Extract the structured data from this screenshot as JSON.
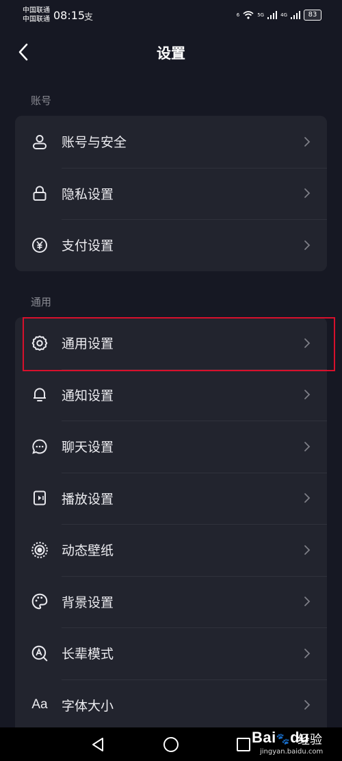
{
  "status_bar": {
    "carrier_1": "中国联通",
    "carrier_2": "中国联通",
    "time": "08:15",
    "notification_icon": "alipay-icon",
    "wifi_label": "6",
    "network_1": "5G",
    "network_2": "4G",
    "battery": "83"
  },
  "header": {
    "title": "设置",
    "back_icon": "chevron-left-icon"
  },
  "sections": [
    {
      "label": "账号",
      "items": [
        {
          "label": "账号与安全",
          "icon": "user-icon"
        },
        {
          "label": "隐私设置",
          "icon": "lock-icon"
        },
        {
          "label": "支付设置",
          "icon": "yen-icon"
        }
      ]
    },
    {
      "label": "通用",
      "items": [
        {
          "label": "通用设置",
          "icon": "gear-icon",
          "highlighted": true
        },
        {
          "label": "通知设置",
          "icon": "bell-icon"
        },
        {
          "label": "聊天设置",
          "icon": "chat-bubble-icon"
        },
        {
          "label": "播放设置",
          "icon": "play-icon"
        },
        {
          "label": "动态壁纸",
          "icon": "wallpaper-icon"
        },
        {
          "label": "背景设置",
          "icon": "palette-icon"
        },
        {
          "label": "长辈模式",
          "icon": "elder-mode-icon"
        },
        {
          "label": "字体大小",
          "icon": "font-size-icon",
          "glyph": "Aa"
        }
      ]
    }
  ],
  "watermark": {
    "brand": "Bai",
    "brand_suffix": "du",
    "cn": "经验",
    "url": "jingyan.baidu.com"
  },
  "colors": {
    "background": "#161823",
    "card": "#22242e",
    "highlight_border": "#d8102c"
  }
}
